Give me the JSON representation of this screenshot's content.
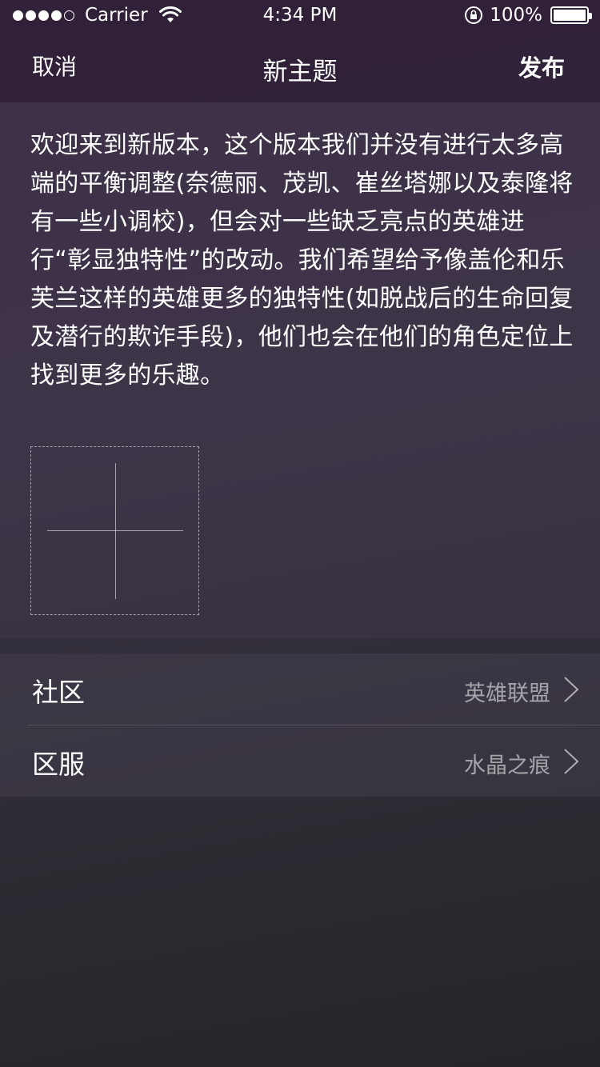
{
  "status_bar": {
    "carrier": "Carrier",
    "time": "4:34 PM",
    "battery_percent": "100%",
    "battery_level": 1.0,
    "signal_bars_filled": 4,
    "signal_bars_total": 5,
    "icons": [
      "signal-dots-icon",
      "wifi-icon",
      "rotation-lock-icon",
      "battery-icon"
    ]
  },
  "nav": {
    "cancel_label": "取消",
    "title": "新主题",
    "publish_label": "发布"
  },
  "post": {
    "body": "欢迎来到新版本，这个版本我们并没有进行太多高端的平衡调整(奈德丽、茂凯、崔丝塔娜以及泰隆将有一些小调校)，但会对一些缺乏亮点的英雄进行“彰显独特性”的改动。我们希望给予像盖伦和乐芙兰这样的英雄更多的独特性(如脱战后的生命回复及潜行的欺诈手段)，他们也会在他们的角色定位上找到更多的乐趣。",
    "add_image_icon": "plus-icon"
  },
  "settings": {
    "rows": [
      {
        "label": "社区",
        "value": "英雄联盟"
      },
      {
        "label": "区服",
        "value": "水晶之痕"
      }
    ]
  },
  "colors": {
    "background_top": "#3a2a45",
    "background_bottom": "#262428",
    "text_primary": "#ffffff",
    "text_secondary": "#9a93a0"
  }
}
